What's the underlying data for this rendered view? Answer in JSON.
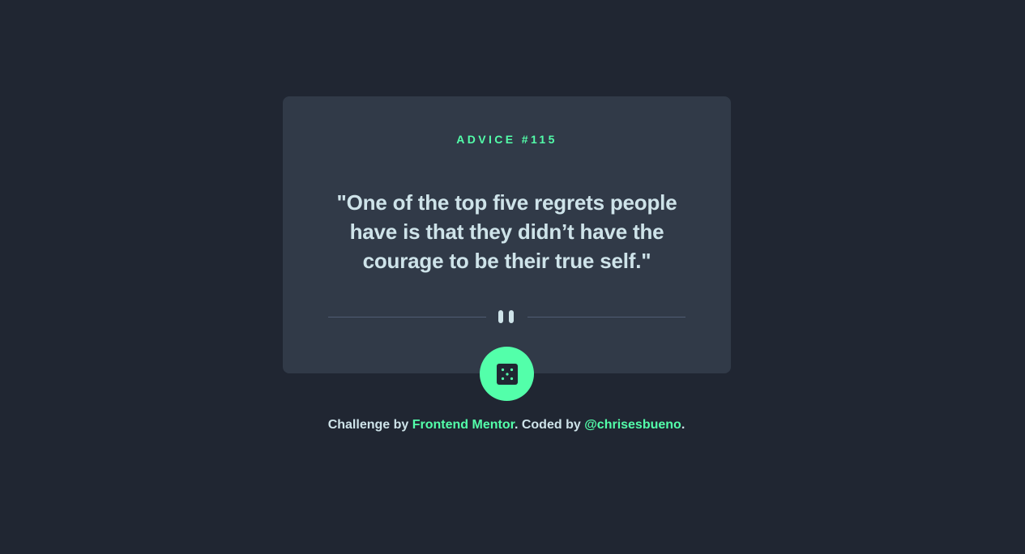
{
  "card": {
    "advice_label": "ADVICE #115",
    "quote": "\"One of the top five regrets people have is that they didn’t have the courage to be their true self.\"",
    "divider_icon": "pause-icon",
    "button_icon": "dice-icon"
  },
  "footer": {
    "prefix": "Challenge by ",
    "link1": "Frontend Mentor",
    "middle": ". Coded by ",
    "link2": "@chrisesbueno",
    "suffix": "."
  },
  "colors": {
    "background": "#202632",
    "card": "#313a48",
    "accent": "#53ffaa",
    "text": "#cee3e9",
    "divider": "#4f5d74"
  }
}
